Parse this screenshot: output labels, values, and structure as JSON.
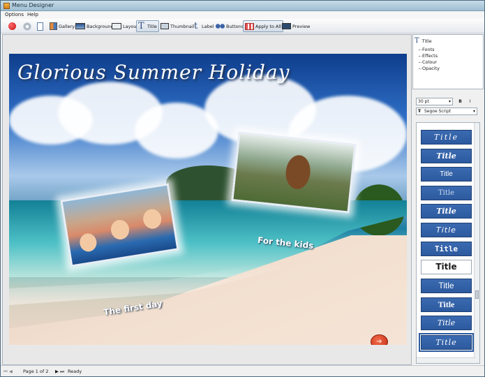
{
  "window": {
    "title": "Menu Designer"
  },
  "menubar": {
    "items": [
      "Options",
      "Help"
    ]
  },
  "toolbar": {
    "buttons": [
      {
        "label": "",
        "icon": "record-icon"
      },
      {
        "label": "",
        "icon": "disc-icon"
      },
      {
        "label": "",
        "icon": "document-icon"
      },
      {
        "label": "Gallery",
        "icon": "gallery-icon"
      },
      {
        "label": "Background",
        "icon": "background-icon"
      },
      {
        "label": "Layout",
        "icon": "layout-icon"
      },
      {
        "label": "Title",
        "icon": "title-icon",
        "active": true
      },
      {
        "label": "Thumbnail",
        "icon": "thumbnail-icon"
      },
      {
        "label": "Label",
        "icon": "label-icon"
      },
      {
        "label": "Buttons",
        "icon": "buttons-icon"
      },
      {
        "label": "Apply to All",
        "icon": "apply-all-icon"
      },
      {
        "label": "Preview",
        "icon": "preview-icon"
      }
    ]
  },
  "canvas": {
    "title": "Glorious Summer Holiday",
    "captions": [
      "The first day",
      "For the kids"
    ],
    "play_button_icon": "play-arrow-icon"
  },
  "properties_tree": {
    "root": "Title",
    "items": [
      "Fonts",
      "Effects",
      "Colour",
      "Opacity"
    ]
  },
  "font_controls": {
    "size": "30 pt",
    "bold": "B",
    "italic": "I",
    "font_name": "Segoe Script"
  },
  "title_gallery": {
    "items": [
      "Title",
      "Title",
      "Title",
      "Title",
      "Title",
      "Title",
      "Title",
      "Title",
      "Title",
      "Title",
      "Title",
      "Title"
    ],
    "selected_index": 11
  },
  "statusbar": {
    "page": "Page 1 of 2",
    "status": "Ready"
  },
  "colors": {
    "accent": "#2d5a9f",
    "title_bar": "#b5cfe0",
    "play_button": "#d8401f"
  }
}
